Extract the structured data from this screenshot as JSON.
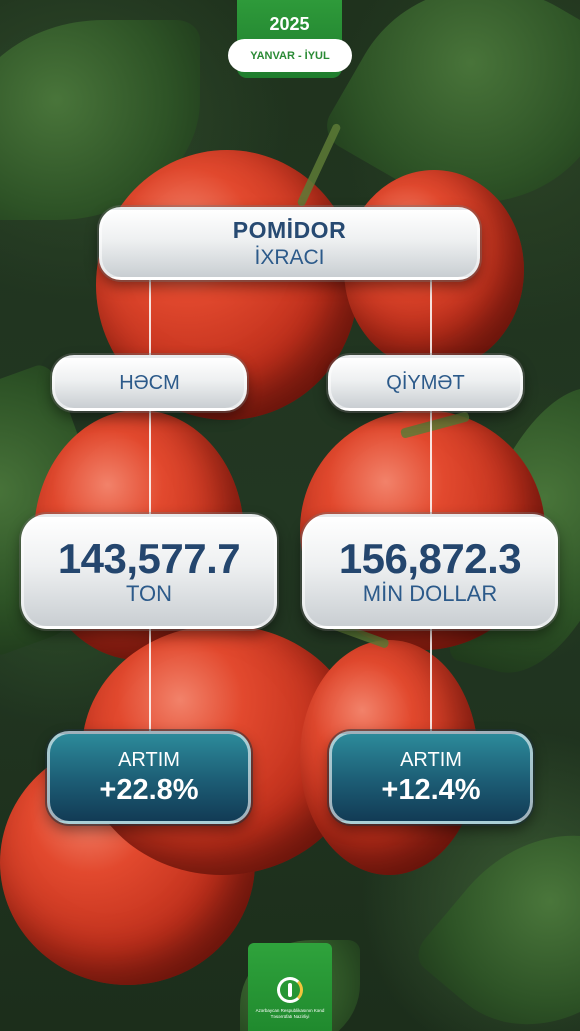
{
  "header": {
    "year": "2025",
    "period": "YANVAR - İYUL"
  },
  "title": {
    "main": "POMİDOR",
    "sub": "İXRACI"
  },
  "columns": [
    {
      "label": "HƏCM",
      "value": "143,577.7",
      "unit": "TON",
      "growth_label": "ARTIM",
      "growth_value": "+22.8%"
    },
    {
      "label": "QİYMƏT",
      "value": "156,872.3",
      "unit": "MİN DOLLAR",
      "growth_label": "ARTIM",
      "growth_value": "+12.4%"
    }
  ],
  "footer": {
    "logo_text": "Azərbaycan Respublikasının Kənd Təsərrüfatı Nazirliyi"
  },
  "colors": {
    "accent_green": "#2a8a35",
    "text_navy": "#274a72",
    "teal": "#1c5c74"
  }
}
